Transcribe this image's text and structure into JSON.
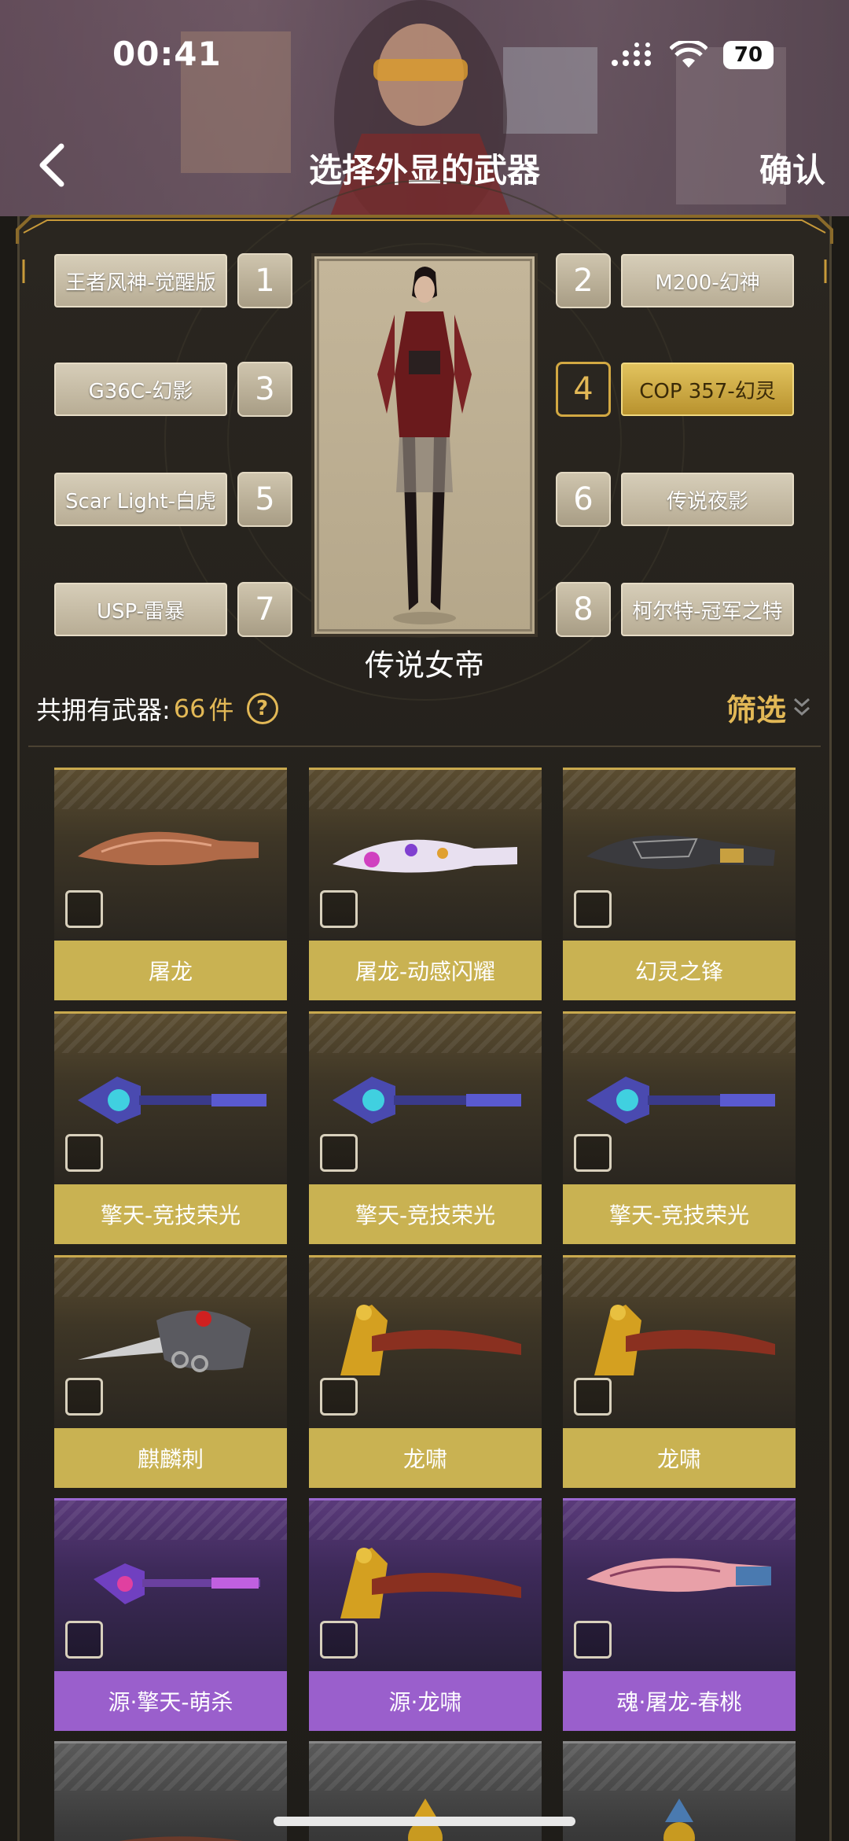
{
  "status_bar": {
    "time": "00:41",
    "battery": "70"
  },
  "header": {
    "title": "选择外显的武器",
    "confirm_label": "确认"
  },
  "slots": [
    {
      "num": "1",
      "name": "王者风神-觉醒版",
      "active": false
    },
    {
      "num": "2",
      "name": "M200-幻神",
      "active": false
    },
    {
      "num": "3",
      "name": "G36C-幻影",
      "active": false
    },
    {
      "num": "4",
      "name": "COP 357-幻灵",
      "active": true
    },
    {
      "num": "5",
      "name": "Scar Light-白虎",
      "active": false
    },
    {
      "num": "6",
      "name": "传说夜影",
      "active": false
    },
    {
      "num": "7",
      "name": "USP-雷暴",
      "active": false
    },
    {
      "num": "8",
      "name": "柯尔特-冠军之特",
      "active": false
    }
  ],
  "character": {
    "name": "传说女帝"
  },
  "summary": {
    "owned_label": "共拥有武器:",
    "owned_count": "66",
    "owned_unit": "件",
    "filter_label": "筛选"
  },
  "weapons": [
    {
      "name": "屠龙",
      "rarity": "gold"
    },
    {
      "name": "屠龙-动感闪耀",
      "rarity": "gold"
    },
    {
      "name": "幻灵之锋",
      "rarity": "gold"
    },
    {
      "name": "擎天-竞技荣光",
      "rarity": "gold"
    },
    {
      "name": "擎天-竞技荣光",
      "rarity": "gold"
    },
    {
      "name": "擎天-竞技荣光",
      "rarity": "gold"
    },
    {
      "name": "麒麟刺",
      "rarity": "gold"
    },
    {
      "name": "龙啸",
      "rarity": "gold"
    },
    {
      "name": "龙啸",
      "rarity": "gold"
    },
    {
      "name": "源·擎天-萌杀",
      "rarity": "purple"
    },
    {
      "name": "源·龙啸",
      "rarity": "purple"
    },
    {
      "name": "魂·屠龙-春桃",
      "rarity": "purple"
    }
  ]
}
